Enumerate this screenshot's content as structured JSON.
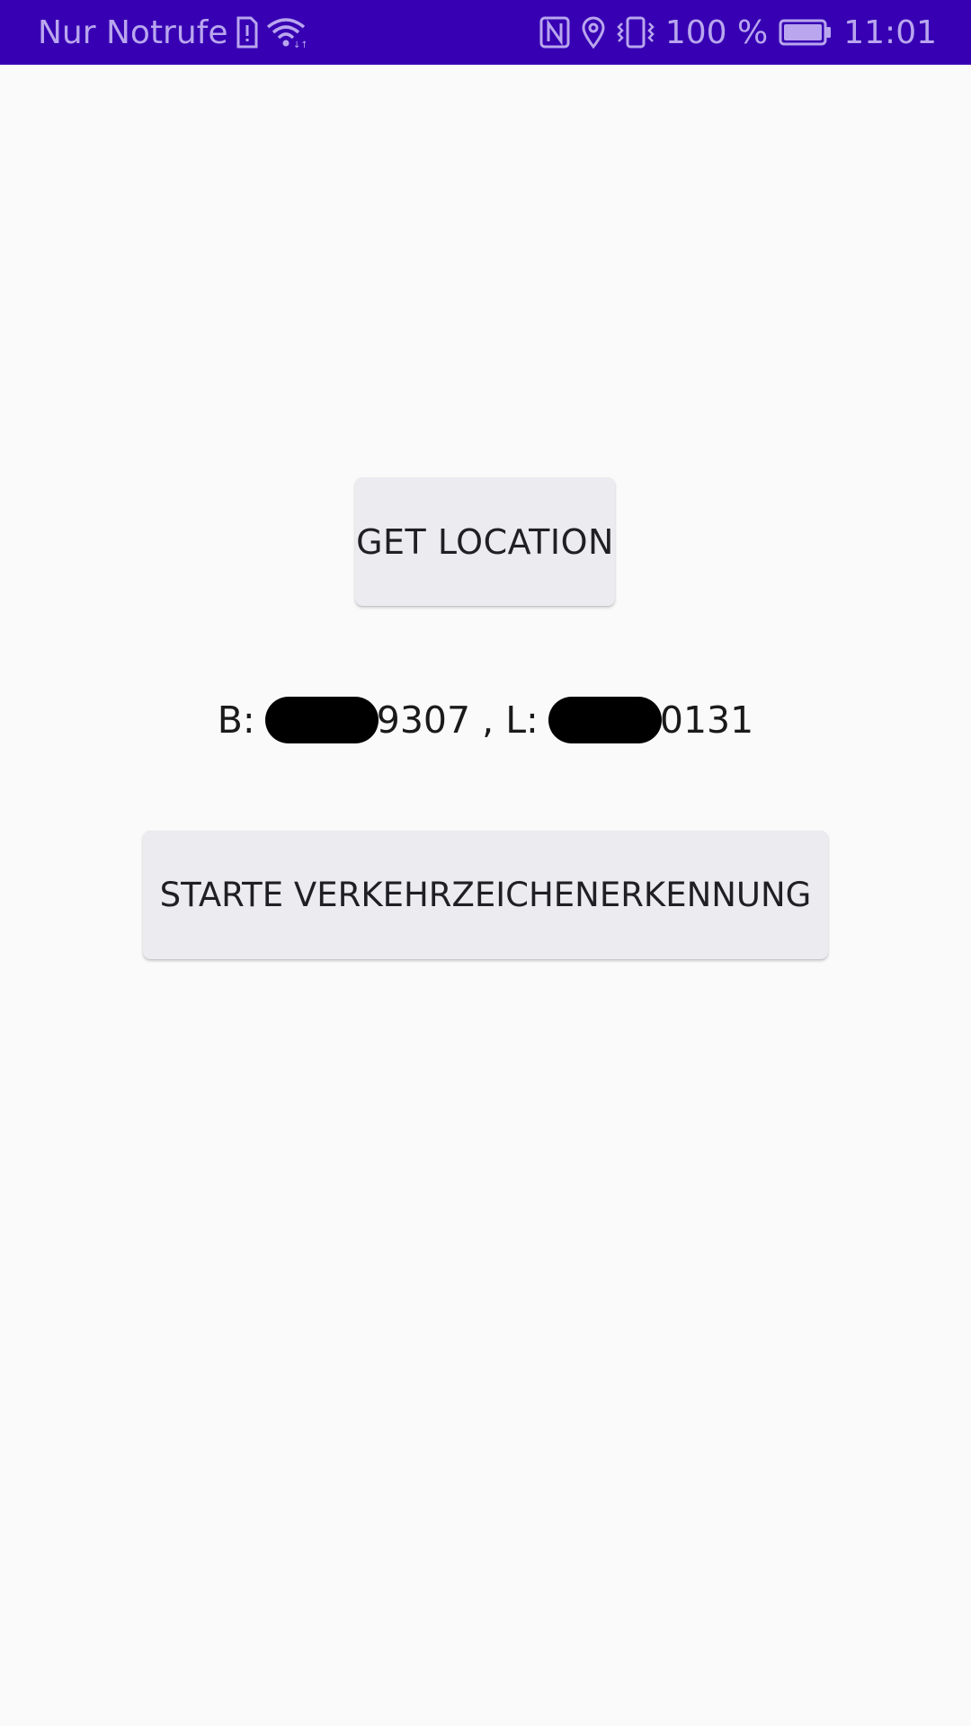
{
  "status_bar": {
    "carrier_text": "Nur Notrufe",
    "battery_percent": "100 %",
    "time": "11:01",
    "icons": [
      "sim-alert-icon",
      "wifi-icon",
      "nfc-icon",
      "location-icon",
      "vibrate-icon",
      "battery-icon"
    ],
    "background_color": "#3700b3",
    "text_color": "#b9a6ee"
  },
  "main": {
    "get_location_label": "GET LOCATION",
    "location": {
      "lat_prefix": "B: ",
      "lat_visible_suffix": "9307",
      "separator": " , L: ",
      "lon_visible_suffix": "0131"
    },
    "start_recognition_label": "STARTE VERKEHRZEICHENERKENNUNG",
    "button_color": "#ebebf0",
    "background_color": "#fafafa"
  }
}
